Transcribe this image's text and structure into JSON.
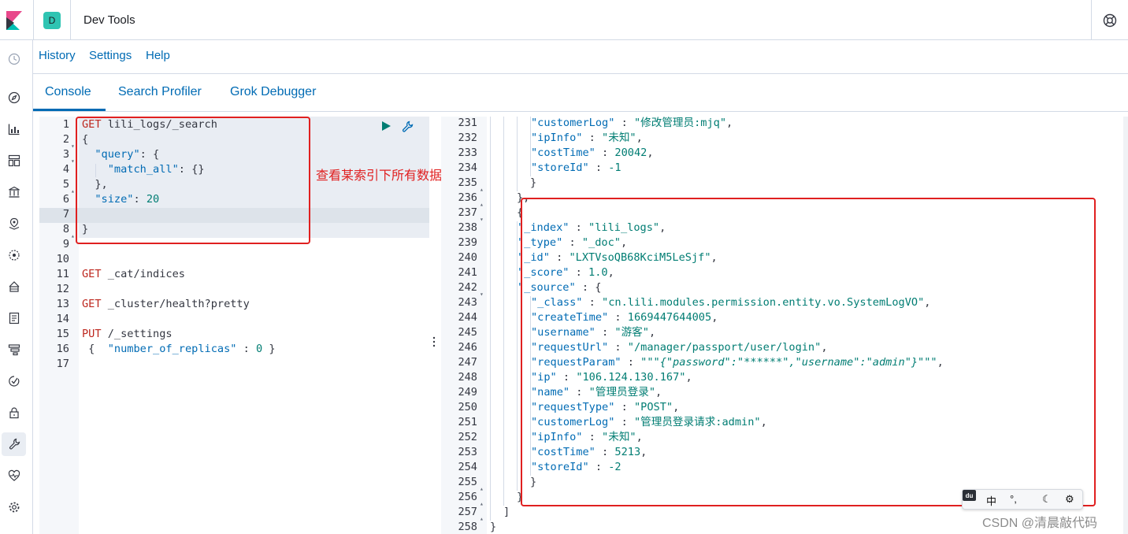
{
  "header": {
    "space_avatar": "D",
    "title": "Dev Tools"
  },
  "topmenu": {
    "history": "History",
    "settings": "Settings",
    "help": "Help"
  },
  "tabs": [
    "Console",
    "Search Profiler",
    "Grok Debugger"
  ],
  "annotation": "查看某索引下所有数据",
  "editor": {
    "line_numbers": [
      "1",
      "2",
      "3",
      "4",
      "5",
      "6",
      "7",
      "8",
      "9",
      "10",
      "11",
      "12",
      "13",
      "14",
      "15",
      "16",
      "17"
    ],
    "request1": {
      "method": "GET",
      "path": "lili_logs/_search"
    },
    "body": {
      "open": "{",
      "query_key": "\"query\"",
      "query_open": ": {",
      "match_all_key": "\"match_all\"",
      "match_all_val": ": {}",
      "query_close": "},",
      "size_key": "\"size\"",
      "size_colon": ": ",
      "size_val": "20",
      "close": "}"
    },
    "request2": {
      "method": "GET",
      "path": "_cat/indices"
    },
    "request3": {
      "method": "GET",
      "path": "_cluster/health?pretty"
    },
    "request4": {
      "method": "PUT",
      "path": "/_settings"
    },
    "request4_body": {
      "open": " {  ",
      "key": "\"number_of_replicas\"",
      "rest": " : ",
      "val": "0",
      "close": " }"
    }
  },
  "output": {
    "line_numbers": [
      "231",
      "232",
      "233",
      "234",
      "235",
      "236",
      "237",
      "238",
      "239",
      "240",
      "241",
      "242",
      "243",
      "244",
      "245",
      "246",
      "247",
      "248",
      "249",
      "250",
      "251",
      "252",
      "253",
      "254",
      "255",
      "256",
      "257",
      "258"
    ],
    "lines": [
      {
        "k": "\"customerLog\"",
        "v": "\"修改管理员:mjq\"",
        "tail": ","
      },
      {
        "k": "\"ipInfo\"",
        "v": "\"未知\"",
        "tail": ","
      },
      {
        "k": "\"costTime\"",
        "v": "20042",
        "tail": ","
      },
      {
        "k": "\"storeId\"",
        "v": "-1",
        "tail": ""
      },
      {
        "k": "",
        "v": "}",
        "tail": ""
      },
      {
        "k": "",
        "v": "},",
        "tail": ""
      },
      {
        "k": "",
        "v": "{",
        "tail": ""
      },
      {
        "k": "\"_index\"",
        "v": "\"lili_logs\"",
        "tail": ","
      },
      {
        "k": "\"_type\"",
        "v": "\"_doc\"",
        "tail": ","
      },
      {
        "k": "\"_id\"",
        "v": "\"LXTVsoQB68KciM5LeSjf\"",
        "tail": ","
      },
      {
        "k": "\"_score\"",
        "v": "1.0",
        "tail": ","
      },
      {
        "k": "\"_source\"",
        "v": "{",
        "tail": ""
      },
      {
        "k": "\"_class\"",
        "v": "\"cn.lili.modules.permission.entity.vo.SystemLogVO\"",
        "tail": ","
      },
      {
        "k": "\"createTime\"",
        "v": "1669447644005",
        "tail": ","
      },
      {
        "k": "\"username\"",
        "v": "\"游客\"",
        "tail": ","
      },
      {
        "k": "\"requestUrl\"",
        "v": "\"/manager/passport/user/login\"",
        "tail": ","
      },
      {
        "k": "\"requestParam\"",
        "v": "\"\"\"{\"password\":\"******\",\"username\":\"admin\"}\"\"\"",
        "tail": ","
      },
      {
        "k": "\"ip\"",
        "v": "\"106.124.130.167\"",
        "tail": ","
      },
      {
        "k": "\"name\"",
        "v": "\"管理员登录\"",
        "tail": ","
      },
      {
        "k": "\"requestType\"",
        "v": "\"POST\"",
        "tail": ","
      },
      {
        "k": "\"customerLog\"",
        "v": "\"管理员登录请求:admin\"",
        "tail": ","
      },
      {
        "k": "\"ipInfo\"",
        "v": "\"未知\"",
        "tail": ","
      },
      {
        "k": "\"costTime\"",
        "v": "5213",
        "tail": ","
      },
      {
        "k": "\"storeId\"",
        "v": "-2",
        "tail": ""
      },
      {
        "k": "",
        "v": "}",
        "tail": ""
      },
      {
        "k": "",
        "v": "}",
        "tail": ""
      },
      {
        "k": "",
        "v": "]",
        "tail": ""
      },
      {
        "k": "",
        "v": "}",
        "tail": ""
      }
    ]
  },
  "ime_toolbar": {
    "logo": "du",
    "lang": "中",
    "punct": "°,",
    "moon": "☾",
    "gear": "⚙"
  },
  "watermark": "CSDN @清晨敲代码"
}
